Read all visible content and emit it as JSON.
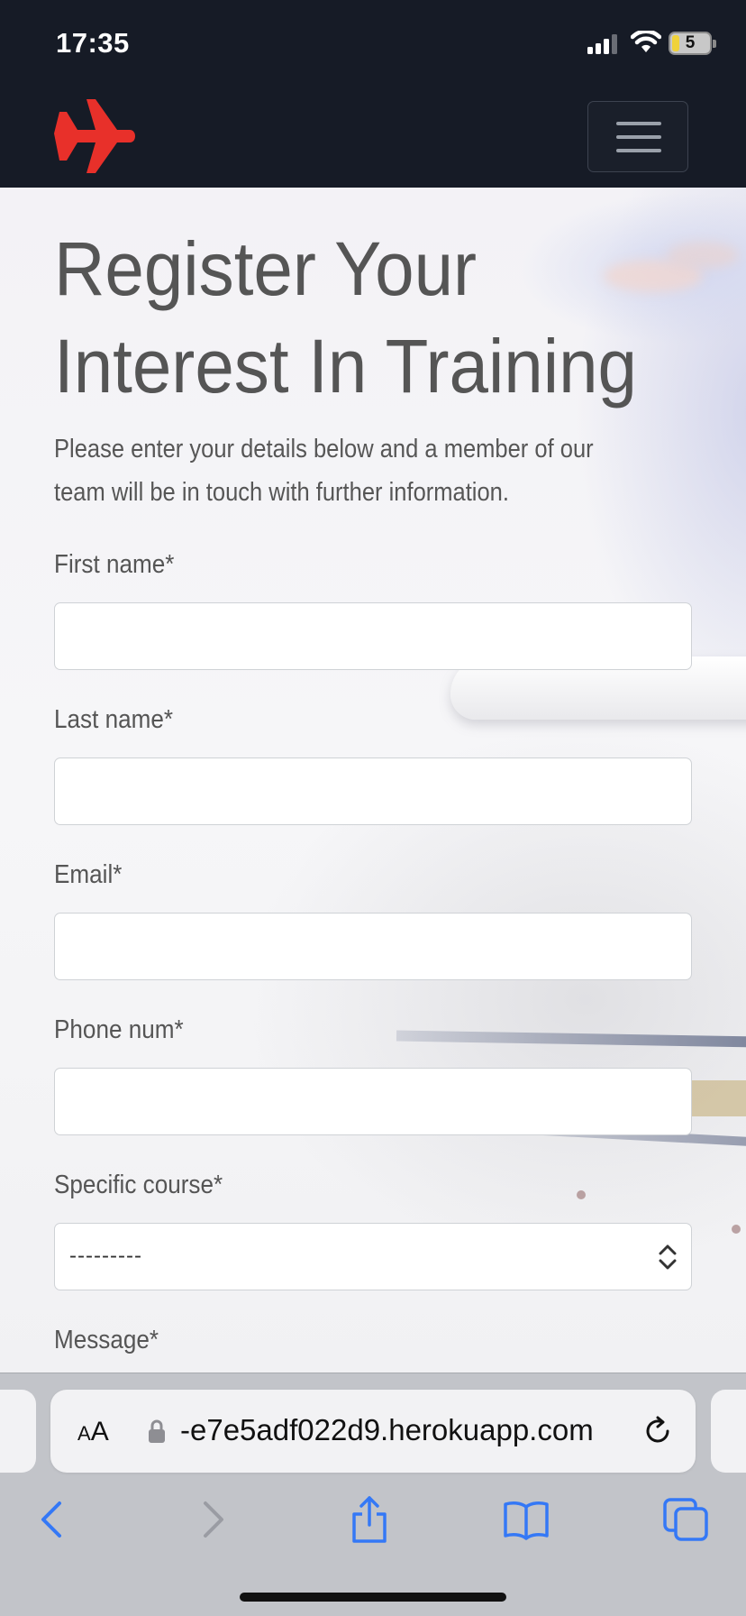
{
  "status_bar": {
    "time": "17:35",
    "battery_level": "5",
    "icons": [
      "signal-icon",
      "wifi-icon",
      "battery-icon"
    ]
  },
  "navbar": {
    "logo_icon": "airplane-icon",
    "logo_color": "#e8302a",
    "menu_icon": "hamburger-menu-icon",
    "background": "#161b26"
  },
  "hero": {
    "title": "Register Your Interest In Training",
    "title_line1": "Register Your",
    "title_line2": "Interest In Training",
    "intro_line1": "Please enter your details below and a member of our",
    "intro_line2": "team will be in touch with further information."
  },
  "form": {
    "first_name_label": "First name*",
    "first_name_value": "",
    "last_name_label": "Last name*",
    "last_name_value": "",
    "email_label": "Email*",
    "email_value": "",
    "phone_label": "Phone num*",
    "phone_value": "",
    "course_label": "Specific course*",
    "course_selected": "---------",
    "message_label": "Message*"
  },
  "browser": {
    "text_size_label_small": "A",
    "text_size_label_large": "A",
    "url": "-e7e5adf022d9.herokuapp.com",
    "toolbar_icons": [
      "back-icon",
      "forward-icon",
      "share-icon",
      "bookmarks-icon",
      "tabs-icon"
    ],
    "accent": "#3478f6"
  }
}
